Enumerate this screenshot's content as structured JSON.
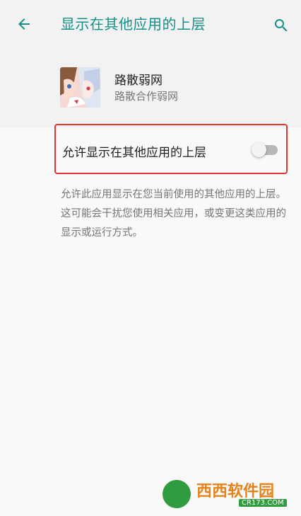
{
  "header": {
    "title": "显示在其他应用的上层",
    "accent_color": "#139189",
    "back_icon": "arrow-left-icon",
    "search_icon": "search-icon"
  },
  "app": {
    "name": "路散弱网",
    "subtitle": "路散合作弱网",
    "icon": "app-icon"
  },
  "setting": {
    "label": "允许显示在其他应用的上层",
    "enabled": false,
    "highlight_color": "#e33434"
  },
  "description": "允许此应用显示在您当前使用的其他应用的上层。这可能会干扰您使用相关应用，或变更这类应用的显示或运行方式。",
  "watermark": {
    "text": "西西软件园",
    "sub": "CR173.COM"
  }
}
